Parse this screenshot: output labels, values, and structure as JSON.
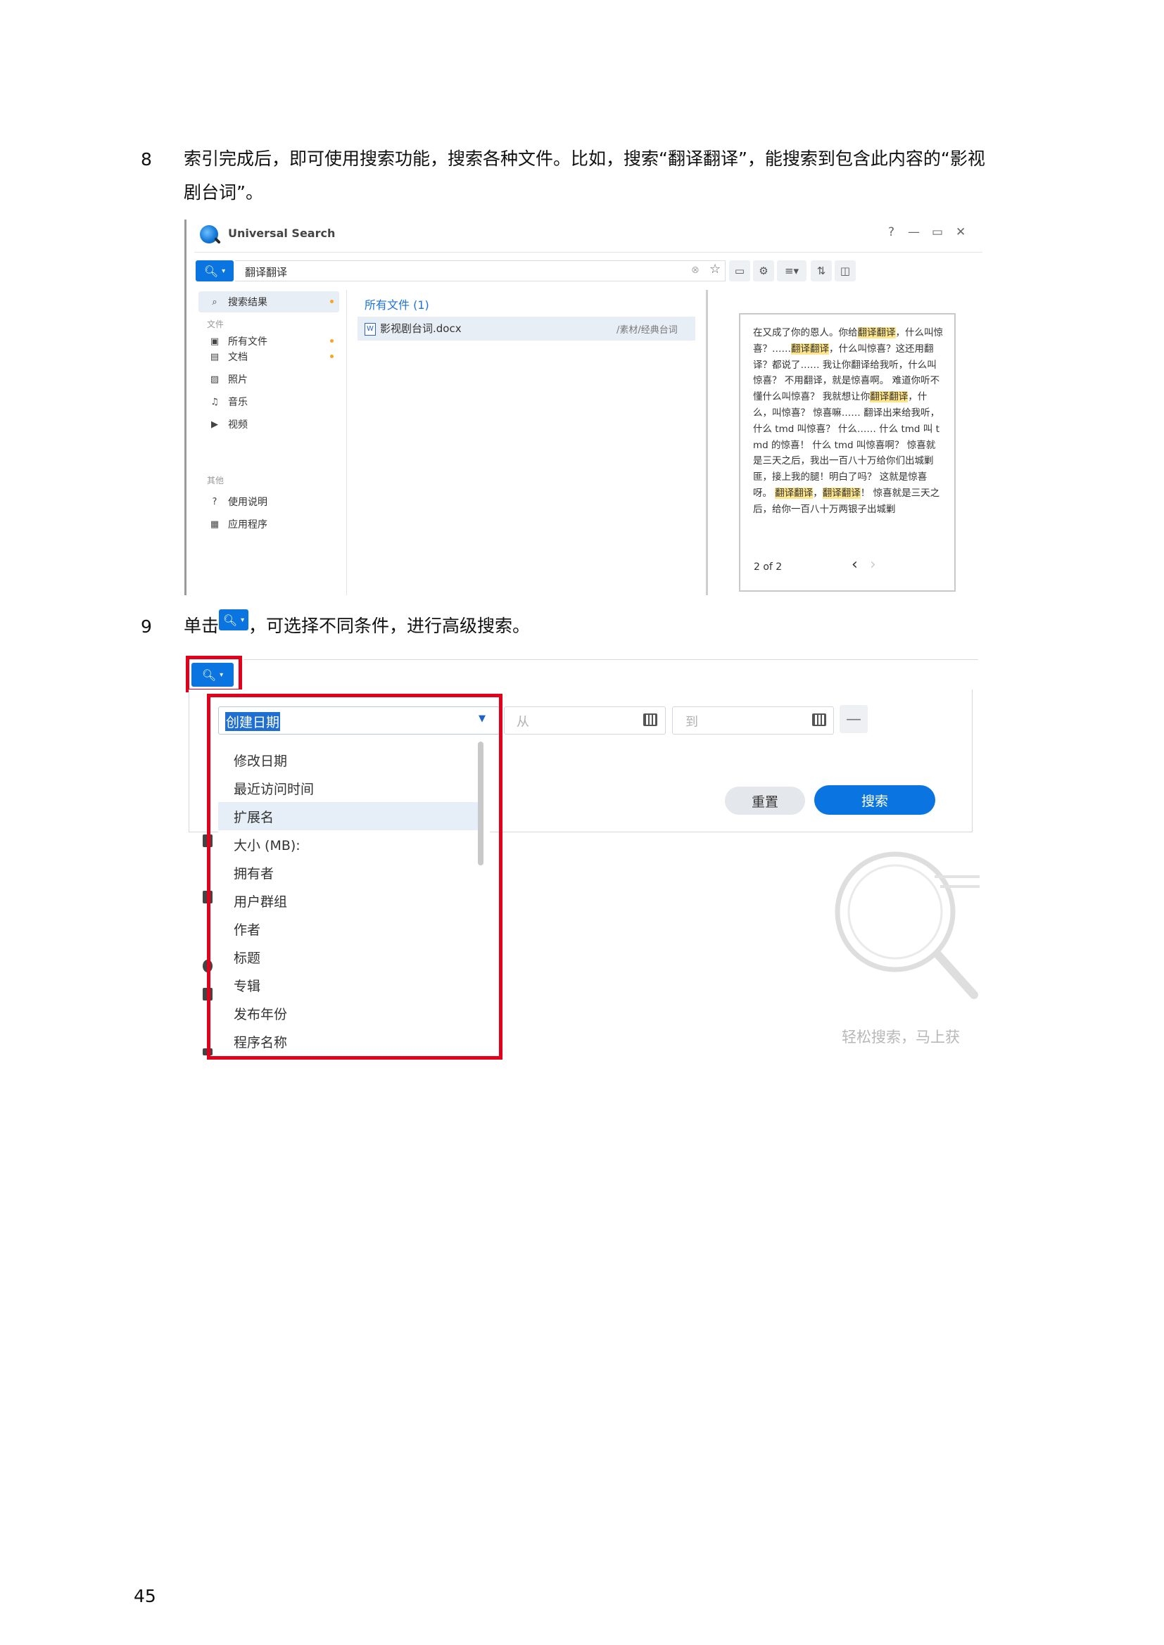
{
  "steps": [
    {
      "num": "8",
      "line1": "索引完成后，即可使用搜索功能，搜索各种文件。比如，搜索“翻译翻译”，能搜索到包含此内容的“影视",
      "line2": "剧台词”。"
    },
    {
      "num": "9",
      "before": "单击",
      "after": "，可选择不同条件，进行高级搜索。"
    }
  ],
  "shot1": {
    "app_title": "Universal Search",
    "controls": {
      "help": "?",
      "minimize": "—",
      "maximize": "▭",
      "close": "✕"
    },
    "search_query": "翻译翻译",
    "sidebar": {
      "results_label": "搜索结果",
      "files_header": "文件",
      "items": [
        {
          "label": "所有文件",
          "icon": "all-files-icon"
        },
        {
          "label": "文档",
          "icon": "document-icon"
        },
        {
          "label": "照片",
          "icon": "photo-icon"
        },
        {
          "label": "音乐",
          "icon": "music-icon"
        },
        {
          "label": "视频",
          "icon": "video-icon"
        }
      ],
      "other_header": "其他",
      "other_items": [
        {
          "label": "使用说明",
          "icon": "help-icon"
        },
        {
          "label": "应用程序",
          "icon": "apps-icon"
        }
      ]
    },
    "list_header": "所有文件 (1)",
    "file": {
      "name": "影视剧台词.docx",
      "path": "/素材/经典台词",
      "icon_letter": "W"
    },
    "preview": {
      "segments": [
        {
          "t": "在又成了你的恩人。你给"
        },
        {
          "t": "翻译翻译",
          "hl": true
        },
        {
          "t": "，什么叫惊喜？……"
        },
        {
          "t": "翻译翻译",
          "hl": true
        },
        {
          "t": "，什么叫惊喜？这还用翻译？都说了…… 我让你翻译给我听，什么叫惊喜？ 不用翻译，就是惊喜啊。 难道你听不懂什么叫惊喜？ 我就想让你"
        },
        {
          "t": "翻译翻译",
          "hl": true
        },
        {
          "t": "，什么，叫惊喜？ 惊喜嘛…… 翻译出来给我听，什么 tmd 叫惊喜？ 什么…… 什么 tmd 叫 tmd 的惊喜！ 什么 tmd 叫惊喜啊？ 惊喜就是三天之后，我出一百八十万给你们出城剿匪，接上我的腿！明白了吗？ 这就是惊喜呀。 "
        },
        {
          "t": "翻译翻译",
          "hl": true
        },
        {
          "t": "，"
        },
        {
          "t": "翻译翻译",
          "hl": true
        },
        {
          "t": "！ 惊喜就是三天之后，给你一百八十万两银子出城剿"
        }
      ],
      "counter": "2 of 2"
    }
  },
  "shot2": {
    "condition_selected": "创建日期",
    "from_placeholder": "从",
    "to_placeholder": "到",
    "reset_label": "重置",
    "search_label": "搜索",
    "options": [
      "修改日期",
      "最近访问时间",
      "扩展名",
      "大小 (MB):",
      "拥有者",
      "用户群组",
      "作者",
      "标题",
      "专辑",
      "发布年份",
      "程序名称"
    ],
    "highlighted_option": "扩展名",
    "empty_text": "轻松搜索，马上获"
  },
  "page_number": "45",
  "colors": {
    "accent": "#0a75e0",
    "outline": "#e3001b",
    "highlight": "#ffe58a"
  }
}
